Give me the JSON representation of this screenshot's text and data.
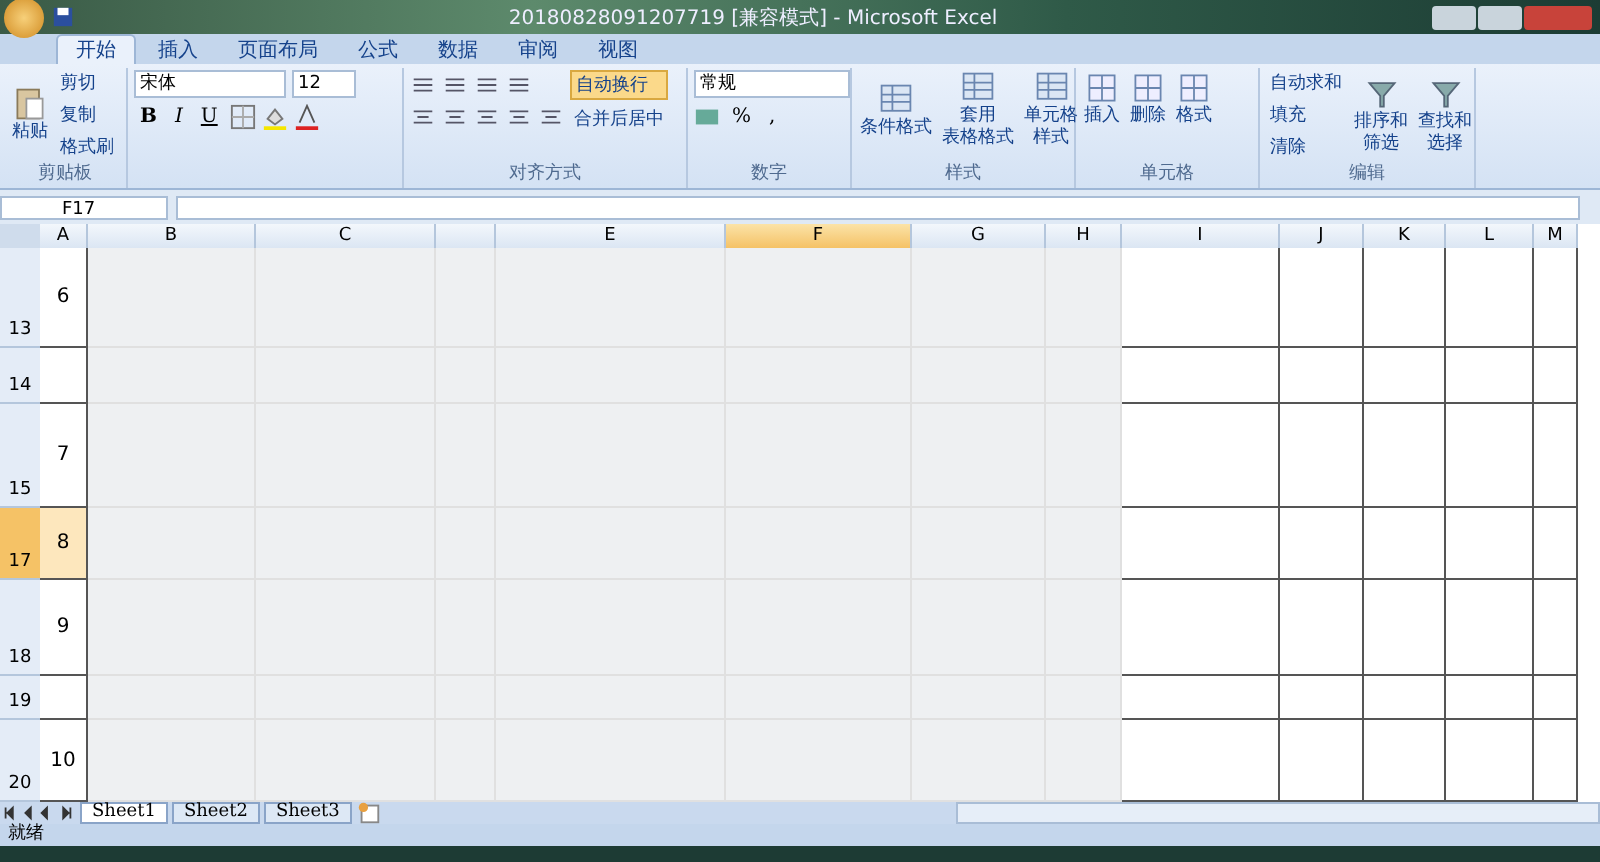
{
  "window": {
    "title": "20180828091207719 [兼容模式] - Microsoft Excel"
  },
  "tabs": [
    {
      "label": "开始",
      "selected": true
    },
    {
      "label": "插入",
      "selected": false
    },
    {
      "label": "页面布局",
      "selected": false
    },
    {
      "label": "公式",
      "selected": false
    },
    {
      "label": "数据",
      "selected": false
    },
    {
      "label": "审阅",
      "selected": false
    },
    {
      "label": "视图",
      "selected": false
    }
  ],
  "clipboard": {
    "paste": "粘贴",
    "items": [
      "剪切",
      "复制",
      "格式刷"
    ],
    "label": "剪贴板"
  },
  "font": {
    "name": "宋体",
    "size": "12",
    "styles": [
      "B",
      "I",
      "U"
    ]
  },
  "alignment": {
    "wrap": {
      "label": "自动换行",
      "on": true
    },
    "merge": "合并后居中",
    "label": "对齐方式"
  },
  "number": {
    "format": "常规",
    "percent": "%",
    "comma": ",",
    "label": "数字"
  },
  "styles": {
    "buttons": [
      [
        "条件格式"
      ],
      [
        "套用",
        "表格格式"
      ],
      [
        "单元格",
        "样式"
      ]
    ],
    "label": "样式"
  },
  "cells": {
    "buttons": [
      "插入",
      "删除",
      "格式"
    ],
    "label": "单元格"
  },
  "editing": {
    "items": [
      "自动求和",
      "填充",
      "清除"
    ],
    "buttons": [
      [
        "排序和",
        "筛选"
      ],
      [
        "查找和",
        "选择"
      ]
    ],
    "label": "编辑"
  },
  "name_box": "F17",
  "columns": [
    {
      "label": "A",
      "selected": false
    },
    {
      "label": "B",
      "selected": false
    },
    {
      "label": "C",
      "selected": false
    },
    {
      "selected": false
    },
    {
      "label": "E",
      "selected": false
    },
    {
      "label": "F",
      "selected": true
    },
    {
      "label": "G",
      "selected": false
    },
    {
      "label": "H",
      "selected": false
    },
    {
      "label": "I",
      "selected": false
    },
    {
      "label": "J",
      "selected": false
    },
    {
      "label": "K",
      "selected": false
    },
    {
      "label": "L",
      "selected": false
    },
    {
      "label": "M",
      "selected": false
    }
  ],
  "rows": [
    {
      "label": "13",
      "selected": false,
      "a": "6"
    },
    {
      "label": "14",
      "selected": false
    },
    {
      "label": "15",
      "selected": false,
      "a": "7"
    },
    {
      "label": "17",
      "selected": true,
      "a": "8"
    },
    {
      "label": "18",
      "selected": false,
      "a": "9"
    },
    {
      "label": "19",
      "selected": false
    },
    {
      "label": "20",
      "selected": false,
      "a": "10"
    }
  ],
  "sheets": [
    {
      "label": "Sheet1",
      "selected": true
    },
    {
      "label": "Sheet2",
      "selected": false
    },
    {
      "label": "Sheet3",
      "selected": false
    }
  ],
  "status_bar": "就绪"
}
